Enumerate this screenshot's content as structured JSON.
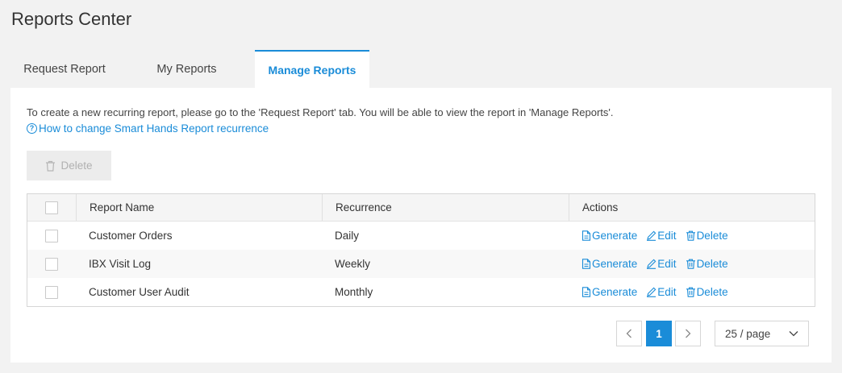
{
  "page": {
    "title": "Reports Center"
  },
  "tabs": [
    {
      "label": "Request Report",
      "active": false
    },
    {
      "label": "My Reports",
      "active": false
    },
    {
      "label": "Manage Reports",
      "active": true
    }
  ],
  "panel": {
    "intro": "To create a new recurring report, please go to the 'Request Report' tab. You will be able to view the report in 'Manage Reports'.",
    "help_link": "How to change Smart Hands Report recurrence",
    "delete_button": "Delete"
  },
  "table": {
    "headers": {
      "name": "Report Name",
      "recurrence": "Recurrence",
      "actions": "Actions"
    },
    "rows": [
      {
        "name": "Customer Orders",
        "recurrence": "Daily"
      },
      {
        "name": "IBX Visit Log",
        "recurrence": "Weekly"
      },
      {
        "name": "Customer User Audit",
        "recurrence": "Monthly"
      }
    ],
    "actions": {
      "generate": "Generate",
      "edit": "Edit",
      "delete": "Delete"
    }
  },
  "pagination": {
    "current_page": "1",
    "page_size": "25 / page"
  },
  "colors": {
    "accent": "#1a8cd8",
    "background": "#f2f2f2",
    "disabled": "#b0b0b0"
  }
}
